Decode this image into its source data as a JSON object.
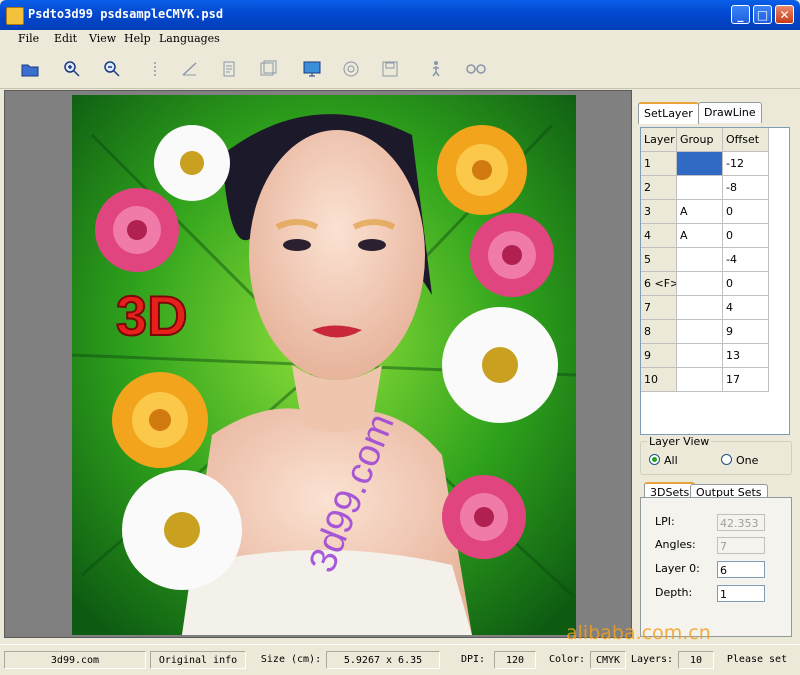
{
  "window": {
    "title": "Psdto3d99 psdsampleCMYK.psd",
    "minimize_icon": "minimize-icon",
    "maximize_icon": "maximize-icon",
    "close_icon": "close-icon"
  },
  "menu": [
    "File",
    "Edit",
    "View",
    "Help",
    "Languages"
  ],
  "toolbar": [
    "open-folder-icon",
    "zoom-in-icon",
    "zoom-out-icon",
    "pen-icon",
    "line-icon",
    "edit-doc-icon",
    "layers-doc-icon",
    "monitor-icon",
    "target-icon",
    "save-icon",
    "person-icon",
    "glasses-icon"
  ],
  "canvas": {
    "badge": "3D",
    "watermark": "3d99.com"
  },
  "panel": {
    "tabs": [
      "SetLayer",
      "DrawLine"
    ],
    "grid_headers": [
      "Layer",
      "Group",
      "Offset"
    ],
    "rows": [
      {
        "layer": "1",
        "group": "",
        "offset": "-12"
      },
      {
        "layer": "2",
        "group": "",
        "offset": "-8"
      },
      {
        "layer": "3",
        "group": "A",
        "offset": "0"
      },
      {
        "layer": "4",
        "group": "A",
        "offset": "0"
      },
      {
        "layer": "5",
        "group": "",
        "offset": "-4"
      },
      {
        "layer": "6 <F>",
        "group": "",
        "offset": "0"
      },
      {
        "layer": "7",
        "group": "",
        "offset": "4"
      },
      {
        "layer": "8",
        "group": "",
        "offset": "9"
      },
      {
        "layer": "9",
        "group": "",
        "offset": "13"
      },
      {
        "layer": "10",
        "group": "",
        "offset": "17"
      }
    ],
    "layer_view": {
      "title": "Layer View",
      "all": "All",
      "one": "One",
      "selected": "All"
    },
    "sets_tabs": [
      "3DSets",
      "Output Sets"
    ],
    "fields": [
      {
        "label": "LPI:",
        "value": "42.353",
        "disabled": true
      },
      {
        "label": "Angles:",
        "value": "7",
        "disabled": true
      },
      {
        "label": "Layer 0:",
        "value": "6",
        "disabled": false
      },
      {
        "label": "Depth:",
        "value": "1",
        "disabled": false
      }
    ]
  },
  "status": {
    "site": "3d99.com",
    "original_info": "Original info",
    "size_label": "Size (cm):",
    "size_value": "5.9267 x 6.35",
    "dpi_label": "DPI:",
    "dpi_value": "120",
    "color_label": "Color:",
    "color_value": "CMYK",
    "layers_label": "Layers:",
    "layers_value": "10",
    "hint": "Please set"
  },
  "overlay_watermark": "alibaba.com.cn"
}
